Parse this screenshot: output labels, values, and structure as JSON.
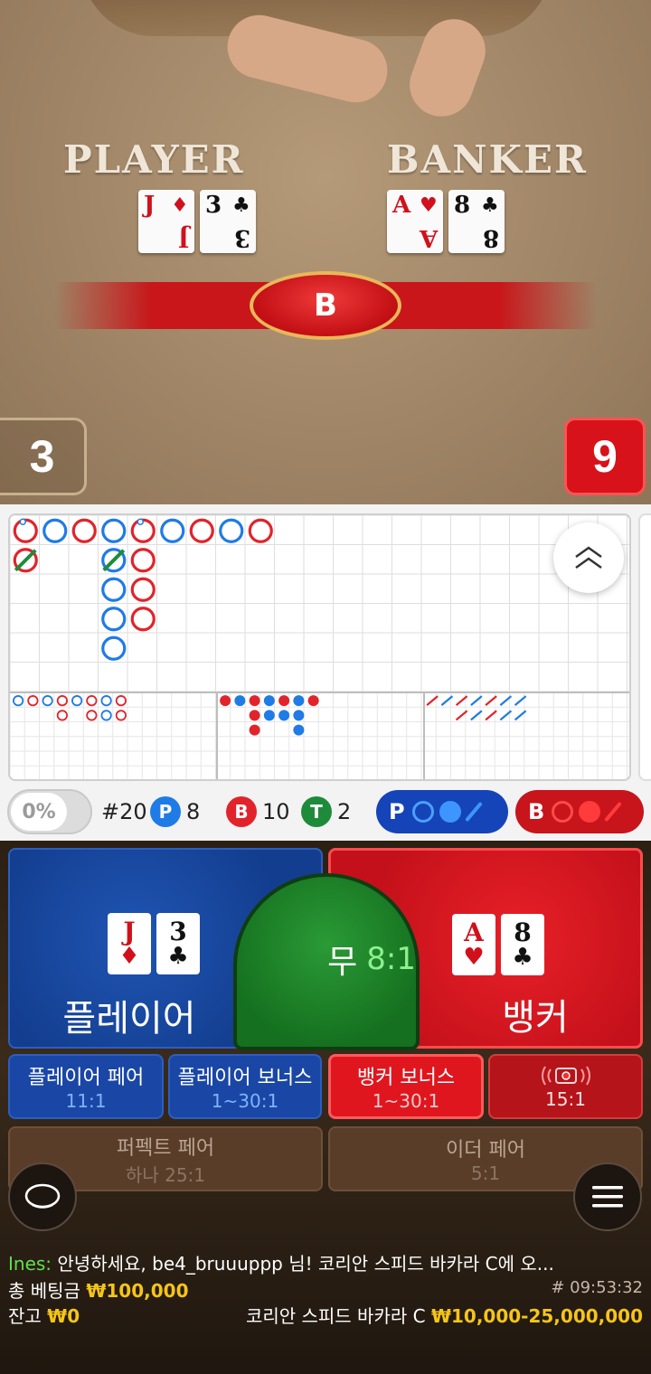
{
  "table": {
    "player_label": "PLAYER",
    "banker_label": "BANKER",
    "player_cards": [
      {
        "rank": "J",
        "suit": "♦",
        "color": "red"
      },
      {
        "rank": "3",
        "suit": "♣",
        "color": "black"
      }
    ],
    "banker_cards": [
      {
        "rank": "A",
        "suit": "♥",
        "color": "red"
      },
      {
        "rank": "8",
        "suit": "♣",
        "color": "black"
      }
    ],
    "winner_badge": "B",
    "player_score": "3",
    "banker_score": "9"
  },
  "roadmap": {
    "big_road": [
      {
        "col": 0,
        "row": 0,
        "side": "B",
        "note": "tie-top"
      },
      {
        "col": 0,
        "row": 1,
        "side": "B",
        "note": "natural-slash"
      },
      {
        "col": 1,
        "row": 0,
        "side": "P"
      },
      {
        "col": 2,
        "row": 0,
        "side": "B"
      },
      {
        "col": 3,
        "row": 0,
        "side": "P"
      },
      {
        "col": 3,
        "row": 1,
        "side": "P",
        "note": "natural-slash"
      },
      {
        "col": 3,
        "row": 2,
        "side": "P"
      },
      {
        "col": 3,
        "row": 3,
        "side": "P"
      },
      {
        "col": 3,
        "row": 4,
        "side": "P"
      },
      {
        "col": 4,
        "row": 0,
        "side": "B",
        "note": "tie-top"
      },
      {
        "col": 4,
        "row": 1,
        "side": "B"
      },
      {
        "col": 4,
        "row": 2,
        "side": "B"
      },
      {
        "col": 4,
        "row": 3,
        "side": "B"
      },
      {
        "col": 5,
        "row": 0,
        "side": "P"
      },
      {
        "col": 6,
        "row": 0,
        "side": "B"
      },
      {
        "col": 7,
        "row": 0,
        "side": "P"
      },
      {
        "col": 8,
        "row": 0,
        "side": "B"
      }
    ],
    "big_eye": [
      {
        "col": 0,
        "row": 0,
        "side": "P"
      },
      {
        "col": 1,
        "row": 0,
        "side": "B"
      },
      {
        "col": 2,
        "row": 0,
        "side": "P"
      },
      {
        "col": 3,
        "row": 0,
        "side": "B"
      },
      {
        "col": 3,
        "row": 1,
        "side": "B"
      },
      {
        "col": 4,
        "row": 0,
        "side": "P"
      },
      {
        "col": 5,
        "row": 0,
        "side": "B"
      },
      {
        "col": 5,
        "row": 1,
        "side": "B"
      },
      {
        "col": 6,
        "row": 0,
        "side": "P"
      },
      {
        "col": 6,
        "row": 1,
        "side": "P"
      },
      {
        "col": 7,
        "row": 0,
        "side": "B"
      },
      {
        "col": 7,
        "row": 1,
        "side": "B"
      }
    ],
    "small_road": [
      {
        "col": 0,
        "row": 0,
        "side": "B"
      },
      {
        "col": 1,
        "row": 0,
        "side": "P"
      },
      {
        "col": 2,
        "row": 0,
        "side": "B"
      },
      {
        "col": 2,
        "row": 1,
        "side": "B"
      },
      {
        "col": 3,
        "row": 0,
        "side": "P"
      },
      {
        "col": 3,
        "row": 1,
        "side": "P"
      },
      {
        "col": 4,
        "row": 0,
        "side": "B"
      },
      {
        "col": 4,
        "row": 1,
        "side": "P"
      },
      {
        "col": 5,
        "row": 0,
        "side": "P"
      },
      {
        "col": 5,
        "row": 1,
        "side": "P"
      },
      {
        "col": 6,
        "row": 0,
        "side": "B"
      },
      {
        "col": 2,
        "row": 2,
        "side": "B"
      },
      {
        "col": 5,
        "row": 2,
        "side": "P"
      }
    ],
    "cockroach": [
      {
        "col": 0,
        "row": 0,
        "side": "B"
      },
      {
        "col": 1,
        "row": 0,
        "side": "P"
      },
      {
        "col": 2,
        "row": 0,
        "side": "B"
      },
      {
        "col": 2,
        "row": 1,
        "side": "B"
      },
      {
        "col": 3,
        "row": 0,
        "side": "P"
      },
      {
        "col": 3,
        "row": 1,
        "side": "P"
      },
      {
        "col": 4,
        "row": 0,
        "side": "B"
      },
      {
        "col": 4,
        "row": 1,
        "side": "B"
      },
      {
        "col": 5,
        "row": 0,
        "side": "P"
      },
      {
        "col": 5,
        "row": 1,
        "side": "P"
      },
      {
        "col": 6,
        "row": 0,
        "side": "P"
      },
      {
        "col": 6,
        "row": 1,
        "side": "P"
      }
    ]
  },
  "stats": {
    "percent_toggle": "0%",
    "round_count": "#20",
    "player_letter": "P",
    "player_count": "8",
    "banker_letter": "B",
    "banker_count": "10",
    "tie_letter": "T",
    "tie_count": "2",
    "predict_player_letter": "P",
    "predict_banker_letter": "B"
  },
  "bets": {
    "player_label": "플레이어",
    "banker_label": "뱅커",
    "tie_label": "무",
    "tie_ratio": "8:1",
    "player_pair_label": "플레이어 페어",
    "player_pair_odds": "11:1",
    "player_bonus_label": "플레이어 보너스",
    "player_bonus_odds": "1~30:1",
    "banker_bonus_label": "뱅커 보너스",
    "banker_bonus_odds": "1~30:1",
    "super_six_odds": "15:1",
    "perfect_pair_label": "퍼펙트 페어",
    "perfect_pair_odds": "하나 25:1",
    "either_pair_label": "이더 페어",
    "either_pair_odds": "5:1"
  },
  "footer": {
    "chat_user": "Ines:",
    "chat_message": " 안녕하세요, be4_bruuuppp 님! 코리안 스피드 바카라 C에 오...",
    "total_bet_label": "총 베팅금",
    "total_bet_value": "₩100,000",
    "balance_label": "잔고",
    "balance_value": "₩0",
    "round_id": "# 09:53:32",
    "table_name": "코리안 스피드 바카라 C",
    "table_limits": "₩10,000-25,000,000"
  },
  "colors": {
    "player_blue": "#1f7be6",
    "banker_red": "#e1242b",
    "tie_green": "#1e8b3b",
    "accent_gold": "#f5c518"
  }
}
